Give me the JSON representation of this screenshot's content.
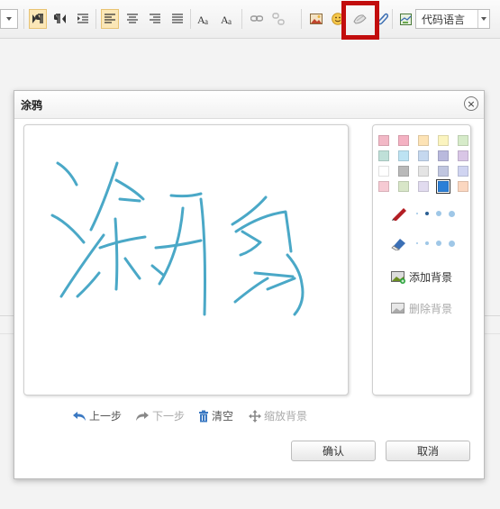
{
  "toolbar": {
    "code_language_select": "代码语言",
    "highlight_color": "#c20d0d"
  },
  "dialog": {
    "title": "涂鸦",
    "close_glyph": "×",
    "palette": [
      "#f2b8c6",
      "#f4b1c2",
      "#fde3b5",
      "#fbf4bf",
      "#d6ebc9",
      "#bfe0d8",
      "#bde3f3",
      "#c5d8ef",
      "#b9b9dd",
      "#d9c6e6",
      "#ffffff",
      "#b9b9b9",
      "#e4e4e4",
      "#c0c6e0",
      "#d0d4f1",
      "#f6cad3",
      "#d8e6c8",
      "#e1dbef",
      "#2b7fd7",
      "#fbd7c0"
    ],
    "selected_color": "#2b7fd7",
    "drawn_text": "涂鸦",
    "stroke_color": "#4aa8c7",
    "panel": {
      "add_background": "添加背景",
      "remove_background": "删除背景"
    },
    "actions": {
      "undo": "上一步",
      "redo": "下一步",
      "clear": "清空",
      "scale_background": "缩放背景"
    },
    "buttons": {
      "confirm": "确认",
      "cancel": "取消"
    }
  }
}
